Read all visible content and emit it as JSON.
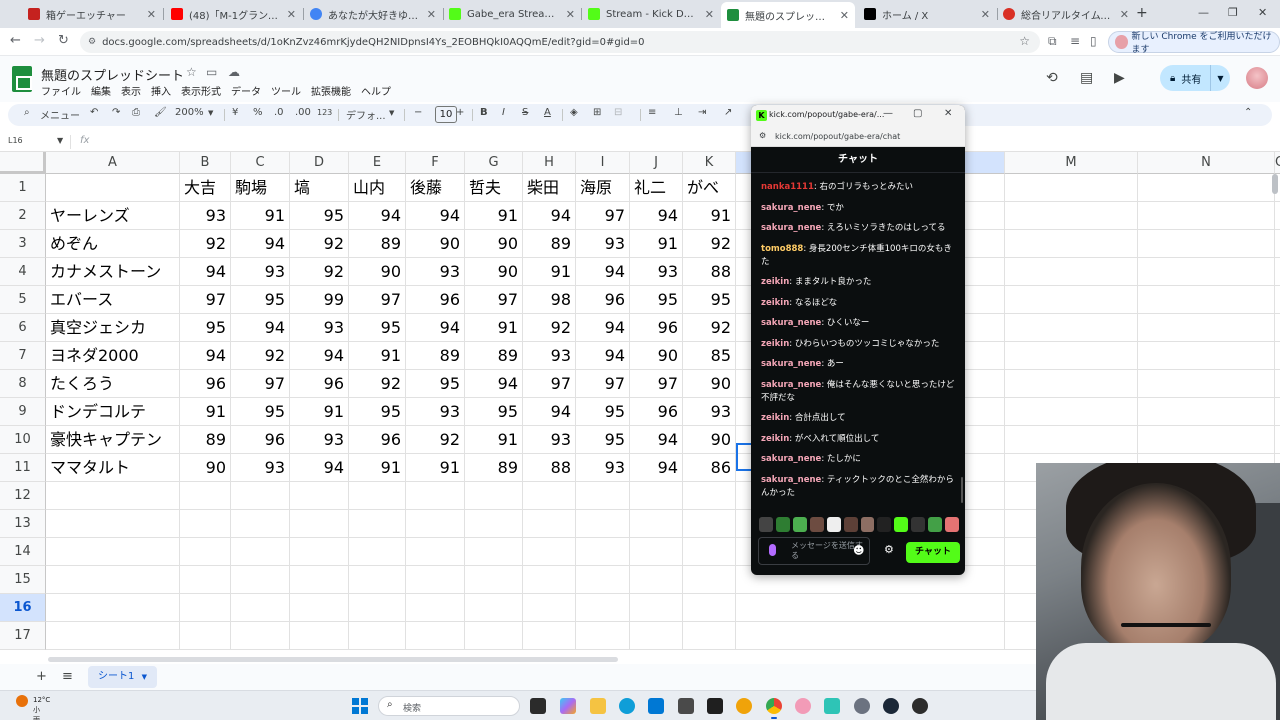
{
  "browser": {
    "tabs": [
      {
        "title": "箱ゲーエッチャー",
        "fav_color": "#c5221f"
      },
      {
        "title": "(48)「M-1グランプリ」を観な",
        "fav_color": "#ff0000"
      },
      {
        "title": "あなたが大好きゆかりちゃん",
        "fav_color": "#4285f4"
      },
      {
        "title": "Gabe_era Stream - Watch",
        "fav_color": "#53fc18"
      },
      {
        "title": "Stream - Kick Dashboard",
        "fav_color": "#53fc18"
      },
      {
        "title": "無題のスプレッドシート - Goo",
        "fav_color": "#1e8e3e"
      },
      {
        "title": "ホーム / X",
        "fav_color": "#000000"
      },
      {
        "title": "総合リアルタイムランキング |",
        "fav_color": "#d93025"
      }
    ],
    "active_tab": 5,
    "url": "docs.google.com/spreadsheets/d/1oKnZvz46mrKjydeQH2NIDpnsI4Ys_2EOBHQkI0AQQmE/edit?gid=0#gid=0",
    "chrome_notice": "新しい Chrome をご利用いただけます"
  },
  "sheets": {
    "title": "無題のスプレッドシート",
    "menu": [
      "ファイル",
      "編集",
      "表示",
      "挿入",
      "表示形式",
      "データ",
      "ツール",
      "拡張機能",
      "ヘルプ"
    ],
    "share_label": "共有",
    "toolbar": {
      "menu_search": "メニュー",
      "zoom": "200%",
      "currency": "¥",
      "percent": "%",
      "decimal_dec": ".0",
      "decimal_inc": ".00",
      "number_format": "123",
      "font": "デフォ...",
      "font_size": "10"
    },
    "name_box": "L16",
    "fx": "fx",
    "columns": [
      "A",
      "B",
      "C",
      "D",
      "E",
      "F",
      "G",
      "H",
      "I",
      "J",
      "K",
      "L",
      "M",
      "N",
      "O"
    ],
    "selected_column": "L",
    "rows": [
      "1",
      "2",
      "3",
      "4",
      "5",
      "6",
      "7",
      "8",
      "9",
      "10",
      "11",
      "12",
      "13",
      "14",
      "15",
      "16",
      "17"
    ],
    "selected_row": "16",
    "header_row": [
      "",
      "大吉",
      "駒場",
      "塙",
      "山内",
      "後藤",
      "哲夫",
      "柴田",
      "海原",
      "礼二",
      "がべ"
    ],
    "data_rows": [
      [
        "ヤーレンズ",
        93,
        91,
        95,
        94,
        94,
        91,
        94,
        97,
        94,
        91
      ],
      [
        "めぞん",
        92,
        94,
        92,
        89,
        90,
        90,
        89,
        93,
        91,
        92
      ],
      [
        "カナメストーン",
        94,
        93,
        92,
        90,
        93,
        90,
        91,
        94,
        93,
        88
      ],
      [
        "エバース",
        97,
        95,
        99,
        97,
        96,
        97,
        98,
        96,
        95,
        95
      ],
      [
        "真空ジェシカ",
        95,
        94,
        93,
        95,
        94,
        91,
        92,
        94,
        96,
        92
      ],
      [
        "ヨネダ2000",
        94,
        92,
        94,
        91,
        89,
        89,
        93,
        94,
        90,
        85
      ],
      [
        "たくろう",
        96,
        97,
        96,
        92,
        95,
        94,
        97,
        97,
        97,
        90
      ],
      [
        "ドンデコルテ",
        91,
        95,
        91,
        95,
        93,
        95,
        94,
        95,
        96,
        93
      ],
      [
        "豪快キャプテン",
        89,
        96,
        93,
        96,
        92,
        91,
        93,
        95,
        94,
        90
      ],
      [
        "ママタルト",
        90,
        93,
        94,
        91,
        91,
        89,
        88,
        93,
        94,
        86
      ]
    ],
    "sheet_tab": "シート1"
  },
  "chat": {
    "window_title": "kick.com/popout/gabe-era/...",
    "url": "kick.com/popout/gabe-era/chat",
    "header": "チャット",
    "messages": [
      {
        "user": "nanka1111",
        "text": "右のゴリラもっとみたい",
        "color": "#e53935"
      },
      {
        "user": "sakura_nene",
        "text": "でか",
        "color": "#f4a6b7"
      },
      {
        "user": "sakura_nene",
        "text": "えろいミソラきたのはしってる",
        "color": "#f4a6b7"
      },
      {
        "user": "tomo888",
        "text": "身長200センチ体重100キロの女もきた",
        "color": "#ffcc66"
      },
      {
        "user": "zeikin",
        "text": "ままタルト良かった",
        "color": "#f4a6b7"
      },
      {
        "user": "zeikin",
        "text": "なるほどな",
        "color": "#f4a6b7"
      },
      {
        "user": "sakura_nene",
        "text": "ひくいなー",
        "color": "#f4a6b7"
      },
      {
        "user": "zeikin",
        "text": "ひわらいつものツッコミじゃなかった",
        "color": "#f4a6b7"
      },
      {
        "user": "sakura_nene",
        "text": "あー",
        "color": "#f4a6b7"
      },
      {
        "user": "sakura_nene",
        "text": "俺はそんな悪くないと思ったけど不評だな",
        "color": "#f4a6b7"
      },
      {
        "user": "zeikin",
        "text": "合計点出して",
        "color": "#f4a6b7"
      },
      {
        "user": "zeikin",
        "text": "がべ入れて順位出して",
        "color": "#f4a6b7"
      },
      {
        "user": "sakura_nene",
        "text": "たしかに",
        "color": "#f4a6b7"
      },
      {
        "user": "sakura_nene",
        "text": "ティックトックのとこ全然わからんかった",
        "color": "#f4a6b7"
      }
    ],
    "input_placeholder": "メッセージを送信する",
    "send_label": "チャット",
    "accent": "#53fc18"
  },
  "taskbar": {
    "temperature": "12°C",
    "condition": "小雨",
    "search_label": "検索"
  }
}
